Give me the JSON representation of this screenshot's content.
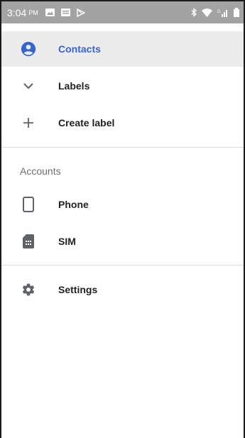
{
  "status_bar": {
    "time": "3:04",
    "ampm": "PM",
    "icons_left": [
      "image-icon",
      "message-icon",
      "play-store-icon"
    ],
    "icons_right": [
      "bluetooth-icon",
      "wifi-icon",
      "signal-icon",
      "battery-icon"
    ]
  },
  "drawer": {
    "items": [
      {
        "id": "contacts",
        "label": "Contacts",
        "icon": "account-circle-icon",
        "active": true
      },
      {
        "id": "labels",
        "label": "Labels",
        "icon": "chevron-down-icon"
      },
      {
        "id": "create-label",
        "label": "Create label",
        "icon": "plus-icon"
      }
    ],
    "accounts_header": "Accounts",
    "accounts": [
      {
        "id": "phone",
        "label": "Phone",
        "icon": "phone-device-icon"
      },
      {
        "id": "sim",
        "label": "SIM",
        "icon": "sim-card-icon"
      }
    ],
    "settings": {
      "label": "Settings",
      "icon": "gear-icon"
    }
  },
  "colors": {
    "accent": "#3565d4",
    "status_bar": "#a3a3a3",
    "active_row": "#ececec",
    "icon": "#5f6368"
  }
}
